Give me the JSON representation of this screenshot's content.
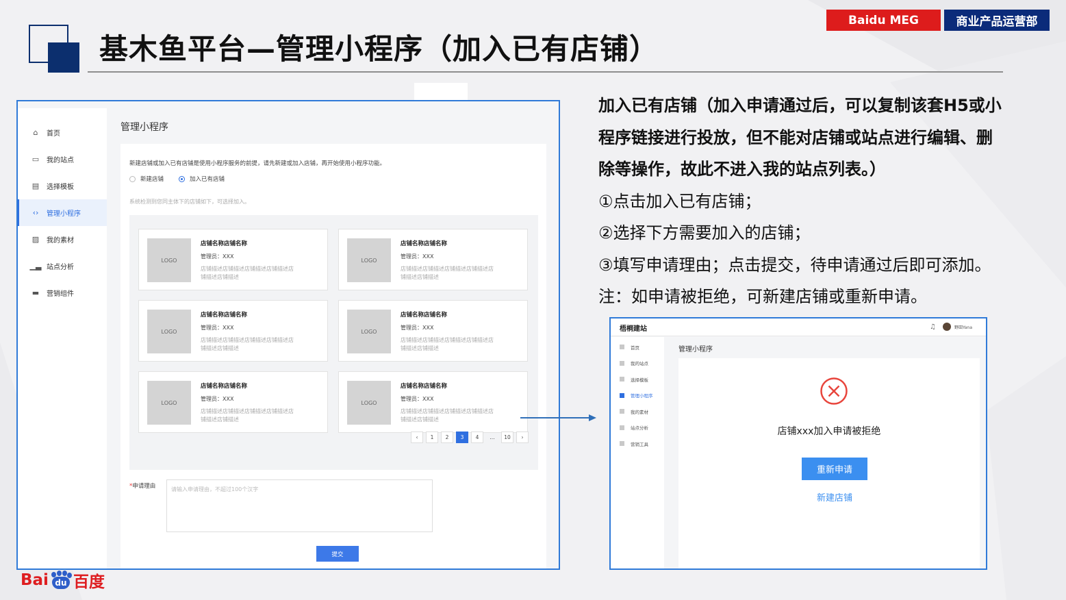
{
  "header": {
    "title": "基木鱼平台—管理小程序（加入已有店铺）",
    "brand_left": "Baidu MEG",
    "brand_right": "商业产品运营部"
  },
  "left_screen": {
    "sidebar": [
      {
        "label": "首页",
        "icon": "home-icon"
      },
      {
        "label": "我的站点",
        "icon": "monitor-icon"
      },
      {
        "label": "选择模板",
        "icon": "template-icon"
      },
      {
        "label": "管理小程序",
        "icon": "code-icon",
        "active": true
      },
      {
        "label": "我的素材",
        "icon": "image-icon"
      },
      {
        "label": "站点分析",
        "icon": "bar-chart-icon"
      },
      {
        "label": "营销组件",
        "icon": "component-icon"
      }
    ],
    "page_title": "管理小程序",
    "notice": "新建店铺或加入已有店铺是使用小程序服务的前提，请先新建或加入店铺，再开始使用小程序功能。",
    "radio_new": "新建店铺",
    "radio_join": "加入已有店铺",
    "hint": "系统检测到您同主体下的店铺如下，可选择加入。",
    "stores": [
      {
        "logo": "LOGO",
        "name": "店铺名称店铺名称",
        "admin": "管理员：XXX",
        "desc": "店铺描述店铺描述店铺描述店铺描述店铺描述店铺描述"
      },
      {
        "logo": "LOGO",
        "name": "店铺名称店铺名称",
        "admin": "管理员：XXX",
        "desc": "店铺描述店铺描述店铺描述店铺描述店铺描述店铺描述"
      },
      {
        "logo": "LOGO",
        "name": "店铺名称店铺名称",
        "admin": "管理员：XXX",
        "desc": "店铺描述店铺描述店铺描述店铺描述店铺描述店铺描述"
      },
      {
        "logo": "LOGO",
        "name": "店铺名称店铺名称",
        "admin": "管理员：XXX",
        "desc": "店铺描述店铺描述店铺描述店铺描述店铺描述店铺描述"
      },
      {
        "logo": "LOGO",
        "name": "店铺名称店铺名称",
        "admin": "管理员：XXX",
        "desc": "店铺描述店铺描述店铺描述店铺描述店铺描述店铺描述"
      },
      {
        "logo": "LOGO",
        "name": "店铺名称店铺名称",
        "admin": "管理员：XXX",
        "desc": "店铺描述店铺描述店铺描述店铺描述店铺描述店铺描述"
      }
    ],
    "pager": [
      "‹",
      "1",
      "2",
      "3",
      "4",
      "...",
      "10",
      "›"
    ],
    "pager_current": "3",
    "reason_label": "申请理由",
    "reason_required": "*",
    "reason_placeholder": "请输入申请理由，不超过100个汉字",
    "submit_label": "提交"
  },
  "description": [
    {
      "text": "加入已有店铺（加入申请通过后，可以复制该套H5或小",
      "bold": true
    },
    {
      "text": "程序链接进行投放，但不能对店铺或站点进行编辑、删",
      "bold": true
    },
    {
      "text": "除等操作，故此不进入我的站点列表。）",
      "bold": true
    },
    {
      "text": "①点击加入已有店铺；",
      "bold": false
    },
    {
      "text": "②选择下方需要加入的店铺；",
      "bold": false
    },
    {
      "text": "③填写申请理由；点击提交，待申请通过后即可添加。",
      "bold": false
    },
    {
      "text": "注：如申请被拒绝，可新建店铺或重新申请。",
      "bold": false
    }
  ],
  "right_screen": {
    "app_name": "梧桐建站",
    "user": "野田Yana",
    "sidebar": [
      {
        "label": "首页"
      },
      {
        "label": "我的站点"
      },
      {
        "label": "选择模板"
      },
      {
        "label": "管理小程序",
        "active": true
      },
      {
        "label": "我的素材"
      },
      {
        "label": "站点分析"
      },
      {
        "label": "营销工具"
      }
    ],
    "page_title": "管理小程序",
    "reject_text": "店铺xxx加入申请被拒绝",
    "reapply_label": "重新申请",
    "new_store_label": "新建店铺"
  },
  "footer": {
    "logo_bai": "Bai",
    "logo_paw": "du",
    "logo_du": "百度"
  },
  "colors": {
    "brand_red": "#dd1c1c",
    "brand_navy": "#0b2b7a",
    "frame_blue": "#2f7ad8",
    "primary_blue": "#2f6fe0"
  }
}
